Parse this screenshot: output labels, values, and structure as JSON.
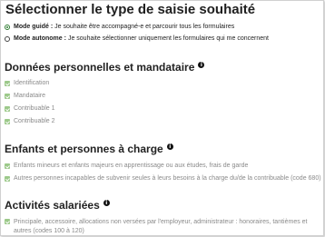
{
  "title": "Sélectionner le type de saisie souhaité",
  "modes": [
    {
      "label": "Mode guidé :",
      "desc": "Je souhaite être accompagné-e et parcourir tous les formulaires",
      "selected": true
    },
    {
      "label": "Mode autonome :",
      "desc": "Je souhaite sélectionner uniquement les formulaires qui me concernent",
      "selected": false
    }
  ],
  "sections": [
    {
      "title": "Données personnelles et mandataire",
      "info_icon": "info-icon",
      "items": [
        "Identification",
        "Mandataire",
        "Contribuable 1",
        "Contribuable 2"
      ]
    },
    {
      "title": "Enfants et personnes à charge",
      "info_icon": "info-icon",
      "items": [
        "Enfants mineurs et enfants majeurs en apprentissage ou aux études, frais de garde",
        "Autres personnes incapables de subvenir seules à leurs besoins à la charge du/de la contribuable (code 680)"
      ]
    },
    {
      "title": "Activités salariées",
      "info_icon": "info-icon",
      "items": [
        "Principale, accessoire, allocations non versées par l'employeur, administrateur : honoraires, tantièmes et autres (codes 100 à 120)"
      ]
    }
  ],
  "colors": {
    "accent": "#2e7d32",
    "check": "#9cc98a",
    "muted_text": "#8a8a8a"
  }
}
